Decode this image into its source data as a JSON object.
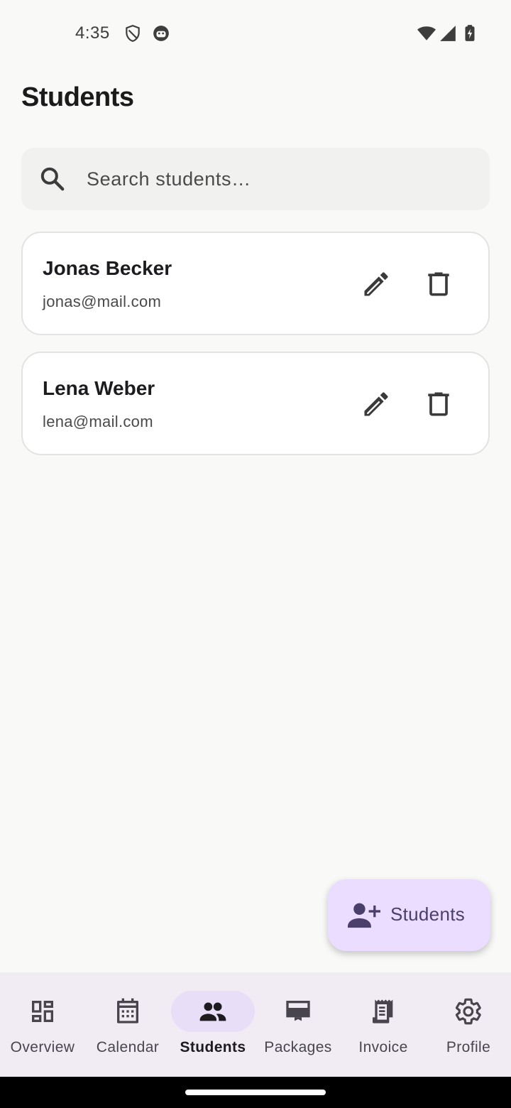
{
  "status_bar": {
    "time": "4:35",
    "icons": [
      "shield-icon",
      "notification-face-icon",
      "wifi-icon",
      "signal-icon",
      "battery-charging-icon"
    ]
  },
  "page": {
    "title": "Students"
  },
  "search": {
    "placeholder": "Search students…",
    "value": ""
  },
  "students": [
    {
      "name": "Jonas Becker",
      "email": "jonas@mail.com"
    },
    {
      "name": "Lena Weber",
      "email": "lena@mail.com"
    }
  ],
  "fab": {
    "label": "Students",
    "icon": "person-add-icon"
  },
  "bottom_nav": {
    "items": [
      {
        "label": "Overview",
        "icon": "dashboard-icon",
        "active": false
      },
      {
        "label": "Calendar",
        "icon": "calendar-icon",
        "active": false
      },
      {
        "label": "Students",
        "icon": "group-icon",
        "active": true
      },
      {
        "label": "Packages",
        "icon": "packages-icon",
        "active": false
      },
      {
        "label": "Invoice",
        "icon": "receipt-icon",
        "active": false
      },
      {
        "label": "Profile",
        "icon": "gear-icon",
        "active": false
      }
    ]
  },
  "colors": {
    "background": "#f9f9f7",
    "card": "#ffffff",
    "fab": "#eaddff",
    "nav_background": "#f1ecf4",
    "nav_active_pill": "#e8def8",
    "icon": "#49454f"
  }
}
